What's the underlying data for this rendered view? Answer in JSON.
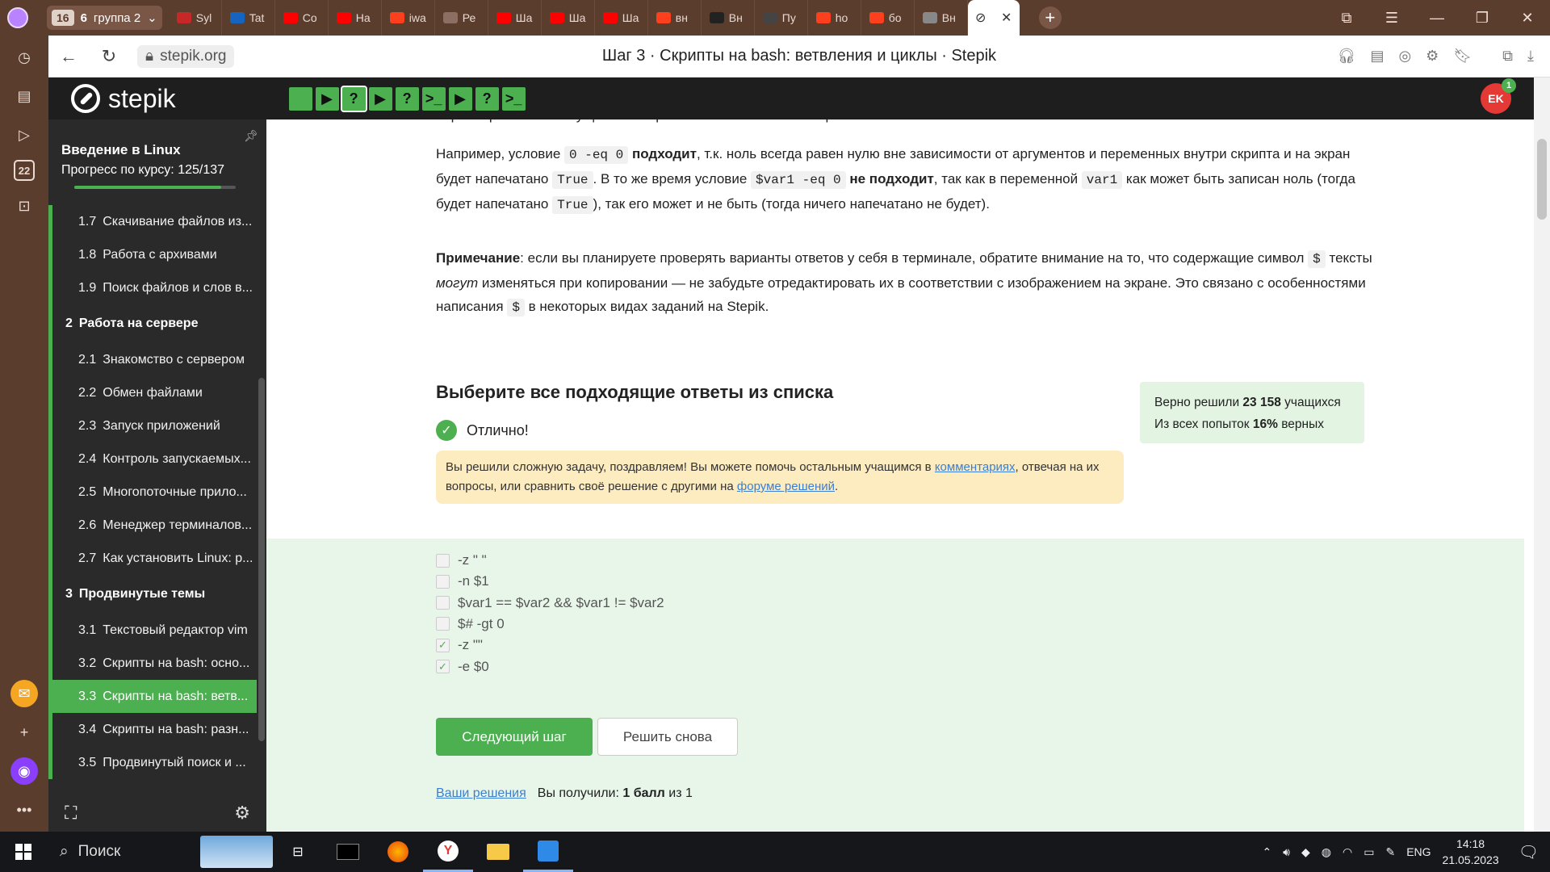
{
  "browser": {
    "tab_group_count": "16",
    "tab_group_items": "6",
    "tab_group_name": "группа 2",
    "tabs": [
      {
        "label": "Syl",
        "icon": "mit-ocw-icon",
        "color": "#c62828"
      },
      {
        "label": "Tat",
        "icon": "globe-icon",
        "color": "#1565c0"
      },
      {
        "label": "Co",
        "icon": "youtube-icon",
        "color": "#ff0000"
      },
      {
        "label": "На",
        "icon": "youtube-icon",
        "color": "#ff0000"
      },
      {
        "label": "iwa",
        "icon": "yandex-icon",
        "color": "#fc3f1d"
      },
      {
        "label": "Ре",
        "icon": "cap-icon",
        "color": "#8d6e63"
      },
      {
        "label": "Ша",
        "icon": "youtube-icon",
        "color": "#ff0000"
      },
      {
        "label": "Ша",
        "icon": "youtube-icon",
        "color": "#ff0000"
      },
      {
        "label": "Ша",
        "icon": "youtube-icon",
        "color": "#ff0000"
      },
      {
        "label": "вн",
        "icon": "yandex-icon",
        "color": "#fc3f1d"
      },
      {
        "label": "Вн",
        "icon": "hiv-icon",
        "color": "#222222"
      },
      {
        "label": "Пу",
        "icon": "printer-icon",
        "color": "#444444"
      },
      {
        "label": "ho",
        "icon": "yandex-icon",
        "color": "#fc3f1d"
      },
      {
        "label": "бо",
        "icon": "yandex-icon",
        "color": "#fc3f1d"
      },
      {
        "label": "Вн",
        "icon": "document-icon",
        "color": "#888888"
      }
    ],
    "url": "stepik.org",
    "page_title": "Шаг 3 · Скрипты на bash: ветвления и циклы · Stepik",
    "sidebar_num": "22"
  },
  "stepik": {
    "logo_text": "stepik",
    "steps": [
      {
        "glyph": "",
        "kind": "blank"
      },
      {
        "glyph": "▶",
        "kind": "video"
      },
      {
        "glyph": "?",
        "kind": "quiz"
      },
      {
        "glyph": "▶",
        "kind": "video"
      },
      {
        "glyph": "?",
        "kind": "quiz"
      },
      {
        "glyph": ">_",
        "kind": "code"
      },
      {
        "glyph": "▶",
        "kind": "video"
      },
      {
        "glyph": "?",
        "kind": "quiz"
      },
      {
        "glyph": ">_",
        "kind": "code"
      }
    ],
    "current_step_index": 2,
    "avatar_initials": "EK",
    "notification_count": "1"
  },
  "course": {
    "title": "Введение в Linux",
    "progress_label": "Прогресс по курсу:",
    "progress_value": "125/137",
    "progress_fraction": 0.912,
    "items": [
      {
        "type": "lesson",
        "num": "1.7",
        "label": "Скачивание файлов из..."
      },
      {
        "type": "lesson",
        "num": "1.8",
        "label": "Работа с архивами"
      },
      {
        "type": "lesson",
        "num": "1.9",
        "label": "Поиск файлов и слов в..."
      },
      {
        "type": "section",
        "num": "2",
        "label": "Работа на сервере"
      },
      {
        "type": "lesson",
        "num": "2.1",
        "label": "Знакомство с сервером"
      },
      {
        "type": "lesson",
        "num": "2.2",
        "label": "Обмен файлами"
      },
      {
        "type": "lesson",
        "num": "2.3",
        "label": "Запуск приложений"
      },
      {
        "type": "lesson",
        "num": "2.4",
        "label": "Контроль запускаемых..."
      },
      {
        "type": "lesson",
        "num": "2.5",
        "label": "Многопоточные прило..."
      },
      {
        "type": "lesson",
        "num": "2.6",
        "label": "Менеджер терминалов..."
      },
      {
        "type": "lesson",
        "num": "2.7",
        "label": "Как установить Linux: р..."
      },
      {
        "type": "section",
        "num": "3",
        "label": "Продвинутые темы"
      },
      {
        "type": "lesson",
        "num": "3.1",
        "label": "Текстовый редактор vim"
      },
      {
        "type": "lesson",
        "num": "3.2",
        "label": "Скрипты на bash: осно..."
      },
      {
        "type": "lesson",
        "num": "3.3",
        "label": "Скрипты на bash: ветв...",
        "active": true
      },
      {
        "type": "lesson",
        "num": "3.4",
        "label": "Скрипты на bash: разн..."
      },
      {
        "type": "lesson",
        "num": "3.5",
        "label": "Продвинутый поиск и ..."
      }
    ]
  },
  "content": {
    "top_cut_text": "параметрами был запущен ваш скрипт и какие в нём есть переменные.",
    "p1": {
      "a": "Например, условие ",
      "code1": "0 -eq 0",
      "b": "подходит",
      "c": ", т.к. ноль всегда равен нулю вне зависимости от аргументов и переменных внутри скрипта и на экран будет напечатано ",
      "code2": "True",
      "d": ". В то же время условие ",
      "code3": "$var1 -eq 0",
      "e": "не подходит",
      "f": ", так как в переменной ",
      "code4": "var1",
      "g": " как может быть записан ноль (тогда будет напечатано ",
      "code5": "True",
      "h": "), так его может и не быть (тогда ничего напечатано не будет)."
    },
    "p2": {
      "a": "Примечание",
      "b": ": если вы планируете проверять варианты ответов у себя в терминале, обратите внимание на то, что содержащие символ ",
      "code1": "$",
      "c": " тексты ",
      "d": "могут",
      "e": " изменяться при копировании — не забудьте отредактировать их в соответствии с изображением на экране. Это связано с особенностями написания ",
      "code2": "$",
      "f": " в некоторых видах заданий на Stepik."
    }
  },
  "quiz": {
    "title": "Выберите все подходящие ответы из списка",
    "status": "Отлично!",
    "congrats_a": "Вы решили сложную задачу, поздравляем! Вы можете помочь остальным учащимся в ",
    "congrats_link1": "комментариях",
    "congrats_b": ", отвечая на их вопросы, или сравнить своё решение с другими на ",
    "congrats_link2": "форуме решений",
    "congrats_c": ".",
    "stats_line1_a": "Верно решили ",
    "stats_line1_b": "23 158",
    "stats_line1_c": " учащихся",
    "stats_line2_a": "Из всех попыток ",
    "stats_line2_b": "16%",
    "stats_line2_c": " верных",
    "choices": [
      {
        "label": "-z \" \"",
        "checked": false
      },
      {
        "label": "-n $1",
        "checked": false
      },
      {
        "label": "$var1 == $var2 && $var1 != $var2",
        "checked": false
      },
      {
        "label": "$# -gt 0",
        "checked": false
      },
      {
        "label": "-z \"\"",
        "checked": true
      },
      {
        "label": "-e $0",
        "checked": true
      }
    ],
    "next_button": "Следующий шаг",
    "retry_button": "Решить снова",
    "your_solutions": "Ваши решения",
    "score_a": "Вы получили: ",
    "score_b": "1 балл",
    "score_c": " из 1"
  },
  "taskbar": {
    "search_placeholder": "Поиск",
    "lang": "ENG",
    "time": "14:18",
    "date": "21.05.2023"
  },
  "colors": {
    "accent": "#4caf50",
    "sidebar_bg": "#2a2a2a",
    "browser_brown": "#5b3d2e",
    "stats_bg": "#e3f4e3",
    "answers_bg": "#e8f5e9",
    "congrats_bg": "#fdecc0"
  }
}
